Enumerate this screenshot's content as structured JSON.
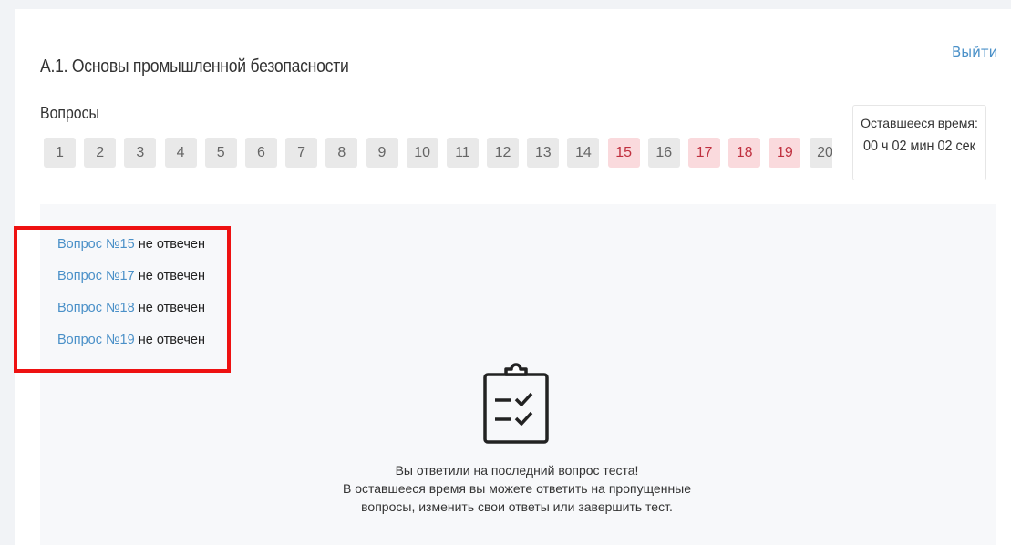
{
  "header": {
    "title": "А.1. Основы промышленной безопасности",
    "exit_label": "Выйти"
  },
  "questions": {
    "label": "Вопросы",
    "items": [
      {
        "label": "1",
        "status": "answered"
      },
      {
        "label": "2",
        "status": "answered"
      },
      {
        "label": "3",
        "status": "answered"
      },
      {
        "label": "4",
        "status": "answered"
      },
      {
        "label": "5",
        "status": "answered"
      },
      {
        "label": "6",
        "status": "answered"
      },
      {
        "label": "7",
        "status": "answered"
      },
      {
        "label": "8",
        "status": "answered"
      },
      {
        "label": "9",
        "status": "answered"
      },
      {
        "label": "10",
        "status": "answered"
      },
      {
        "label": "11",
        "status": "answered"
      },
      {
        "label": "12",
        "status": "answered"
      },
      {
        "label": "13",
        "status": "answered"
      },
      {
        "label": "14",
        "status": "answered"
      },
      {
        "label": "15",
        "status": "unanswered"
      },
      {
        "label": "16",
        "status": "answered"
      },
      {
        "label": "17",
        "status": "unanswered"
      },
      {
        "label": "18",
        "status": "unanswered"
      },
      {
        "label": "19",
        "status": "unanswered"
      },
      {
        "label": "20",
        "status": "answered"
      }
    ]
  },
  "timer": {
    "label": "Оставшееся время:",
    "value": "00 ч 02 мин 02 сек"
  },
  "missed": [
    {
      "link": "Вопрос №15",
      "status": " не отвечен"
    },
    {
      "link": "Вопрос №17",
      "status": " не отвечен"
    },
    {
      "link": "Вопрос №18",
      "status": " не отвечен"
    },
    {
      "link": "Вопрос №19",
      "status": " не отвечен"
    }
  ],
  "message": {
    "line1": "Вы ответили на последний вопрос теста!",
    "line2": "В оставшееся время вы можете ответить на пропущенные",
    "line3": "вопросы, изменить свои ответы или завершить тест."
  },
  "colors": {
    "link": "#4a90c8",
    "unanswered_bg": "#fadadd",
    "unanswered_text": "#c0303f",
    "answered_bg": "#e9e9e9",
    "highlight_frame": "#ee1111"
  },
  "icons": {
    "checklist": "clipboard-check-icon"
  }
}
